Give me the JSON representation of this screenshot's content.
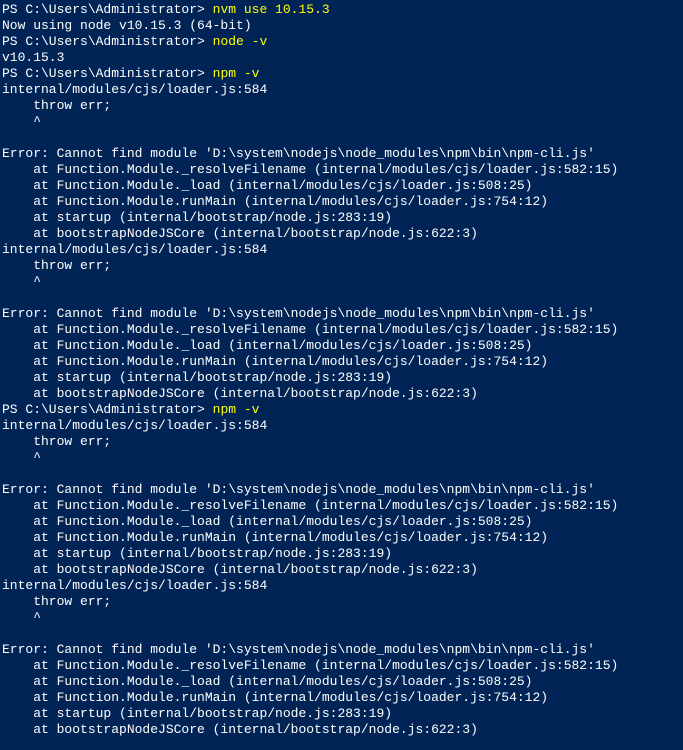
{
  "lines": [
    {
      "segments": [
        {
          "text": "PS C:\\Users\\Administrator> ",
          "class": ""
        },
        {
          "text": "nvm use 10.15.3",
          "class": "yellow"
        }
      ]
    },
    {
      "segments": [
        {
          "text": "Now using node v10.15.3 (64-bit)",
          "class": ""
        }
      ]
    },
    {
      "segments": [
        {
          "text": "PS C:\\Users\\Administrator> ",
          "class": ""
        },
        {
          "text": "node -v",
          "class": "yellow"
        }
      ]
    },
    {
      "segments": [
        {
          "text": "v10.15.3",
          "class": ""
        }
      ]
    },
    {
      "segments": [
        {
          "text": "PS C:\\Users\\Administrator> ",
          "class": ""
        },
        {
          "text": "npm -v",
          "class": "yellow"
        }
      ]
    },
    {
      "segments": [
        {
          "text": "internal/modules/cjs/loader.js:584",
          "class": ""
        }
      ]
    },
    {
      "segments": [
        {
          "text": "    throw err;",
          "class": ""
        }
      ]
    },
    {
      "segments": [
        {
          "text": "    ^",
          "class": ""
        }
      ]
    },
    {
      "segments": [
        {
          "text": "",
          "class": ""
        }
      ]
    },
    {
      "segments": [
        {
          "text": "Error: Cannot find module 'D:\\system\\nodejs\\node_modules\\npm\\bin\\npm-cli.js'",
          "class": ""
        }
      ]
    },
    {
      "segments": [
        {
          "text": "    at Function.Module._resolveFilename (internal/modules/cjs/loader.js:582:15)",
          "class": ""
        }
      ]
    },
    {
      "segments": [
        {
          "text": "    at Function.Module._load (internal/modules/cjs/loader.js:508:25)",
          "class": ""
        }
      ]
    },
    {
      "segments": [
        {
          "text": "    at Function.Module.runMain (internal/modules/cjs/loader.js:754:12)",
          "class": ""
        }
      ]
    },
    {
      "segments": [
        {
          "text": "    at startup (internal/bootstrap/node.js:283:19)",
          "class": ""
        }
      ]
    },
    {
      "segments": [
        {
          "text": "    at bootstrapNodeJSCore (internal/bootstrap/node.js:622:3)",
          "class": ""
        }
      ]
    },
    {
      "segments": [
        {
          "text": "internal/modules/cjs/loader.js:584",
          "class": ""
        }
      ]
    },
    {
      "segments": [
        {
          "text": "    throw err;",
          "class": ""
        }
      ]
    },
    {
      "segments": [
        {
          "text": "    ^",
          "class": ""
        }
      ]
    },
    {
      "segments": [
        {
          "text": "",
          "class": ""
        }
      ]
    },
    {
      "segments": [
        {
          "text": "Error: Cannot find module 'D:\\system\\nodejs\\node_modules\\npm\\bin\\npm-cli.js'",
          "class": ""
        }
      ]
    },
    {
      "segments": [
        {
          "text": "    at Function.Module._resolveFilename (internal/modules/cjs/loader.js:582:15)",
          "class": ""
        }
      ]
    },
    {
      "segments": [
        {
          "text": "    at Function.Module._load (internal/modules/cjs/loader.js:508:25)",
          "class": ""
        }
      ]
    },
    {
      "segments": [
        {
          "text": "    at Function.Module.runMain (internal/modules/cjs/loader.js:754:12)",
          "class": ""
        }
      ]
    },
    {
      "segments": [
        {
          "text": "    at startup (internal/bootstrap/node.js:283:19)",
          "class": ""
        }
      ]
    },
    {
      "segments": [
        {
          "text": "    at bootstrapNodeJSCore (internal/bootstrap/node.js:622:3)",
          "class": ""
        }
      ]
    },
    {
      "segments": [
        {
          "text": "PS C:\\Users\\Administrator> ",
          "class": ""
        },
        {
          "text": "npm -v",
          "class": "yellow"
        }
      ]
    },
    {
      "segments": [
        {
          "text": "internal/modules/cjs/loader.js:584",
          "class": ""
        }
      ]
    },
    {
      "segments": [
        {
          "text": "    throw err;",
          "class": ""
        }
      ]
    },
    {
      "segments": [
        {
          "text": "    ^",
          "class": ""
        }
      ]
    },
    {
      "segments": [
        {
          "text": "",
          "class": ""
        }
      ]
    },
    {
      "segments": [
        {
          "text": "Error: Cannot find module 'D:\\system\\nodejs\\node_modules\\npm\\bin\\npm-cli.js'",
          "class": ""
        }
      ]
    },
    {
      "segments": [
        {
          "text": "    at Function.Module._resolveFilename (internal/modules/cjs/loader.js:582:15)",
          "class": ""
        }
      ]
    },
    {
      "segments": [
        {
          "text": "    at Function.Module._load (internal/modules/cjs/loader.js:508:25)",
          "class": ""
        }
      ]
    },
    {
      "segments": [
        {
          "text": "    at Function.Module.runMain (internal/modules/cjs/loader.js:754:12)",
          "class": ""
        }
      ]
    },
    {
      "segments": [
        {
          "text": "    at startup (internal/bootstrap/node.js:283:19)",
          "class": ""
        }
      ]
    },
    {
      "segments": [
        {
          "text": "    at bootstrapNodeJSCore (internal/bootstrap/node.js:622:3)",
          "class": ""
        }
      ]
    },
    {
      "segments": [
        {
          "text": "internal/modules/cjs/loader.js:584",
          "class": ""
        }
      ]
    },
    {
      "segments": [
        {
          "text": "    throw err;",
          "class": ""
        }
      ]
    },
    {
      "segments": [
        {
          "text": "    ^",
          "class": ""
        }
      ]
    },
    {
      "segments": [
        {
          "text": "",
          "class": ""
        }
      ]
    },
    {
      "segments": [
        {
          "text": "Error: Cannot find module 'D:\\system\\nodejs\\node_modules\\npm\\bin\\npm-cli.js'",
          "class": ""
        }
      ]
    },
    {
      "segments": [
        {
          "text": "    at Function.Module._resolveFilename (internal/modules/cjs/loader.js:582:15)",
          "class": ""
        }
      ]
    },
    {
      "segments": [
        {
          "text": "    at Function.Module._load (internal/modules/cjs/loader.js:508:25)",
          "class": ""
        }
      ]
    },
    {
      "segments": [
        {
          "text": "    at Function.Module.runMain (internal/modules/cjs/loader.js:754:12)",
          "class": ""
        }
      ]
    },
    {
      "segments": [
        {
          "text": "    at startup (internal/bootstrap/node.js:283:19)",
          "class": ""
        }
      ]
    },
    {
      "segments": [
        {
          "text": "    at bootstrapNodeJSCore (internal/bootstrap/node.js:622:3)",
          "class": ""
        }
      ]
    }
  ]
}
